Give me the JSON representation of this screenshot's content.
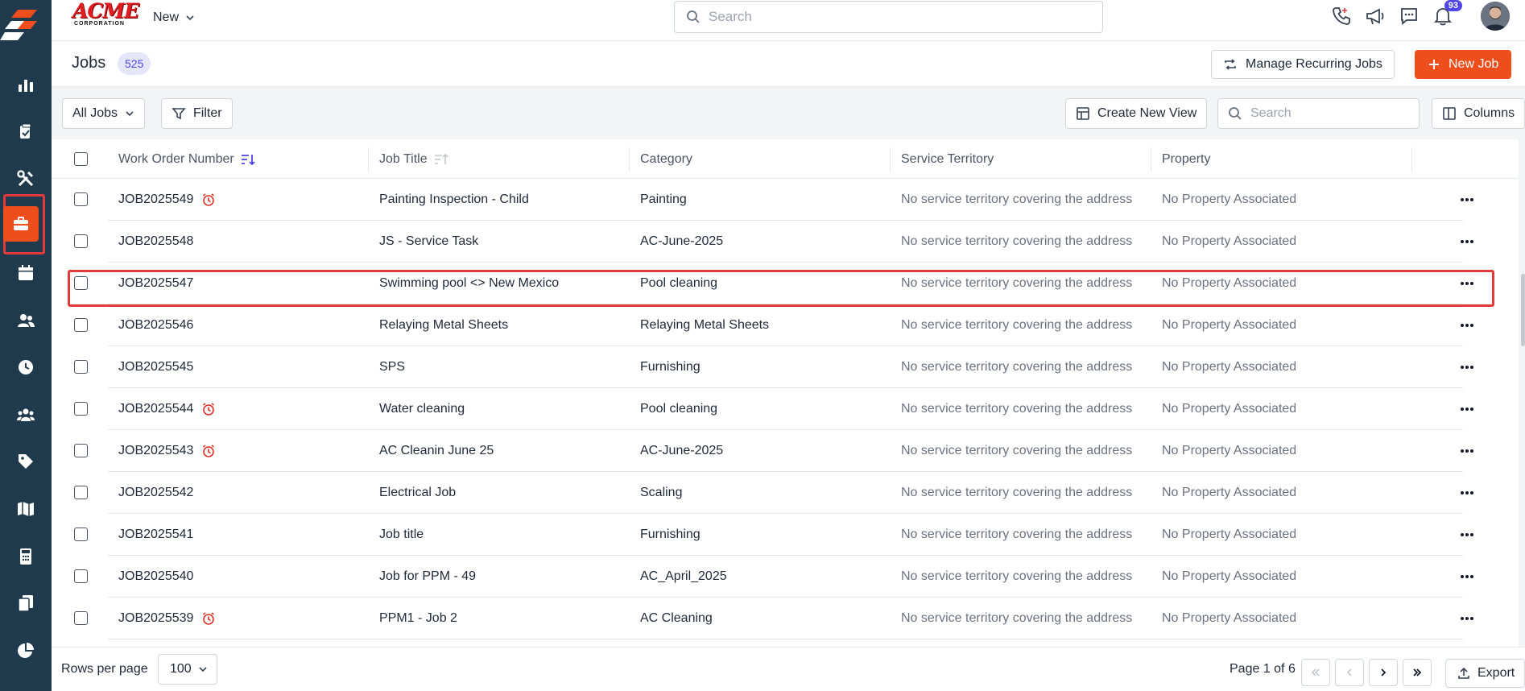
{
  "brand": {
    "name": "ACME",
    "tagline": "CORPORATION"
  },
  "header": {
    "new_label": "New",
    "search_placeholder": "Search",
    "notification_count": "93"
  },
  "title_bar": {
    "title": "Jobs",
    "count": "525",
    "manage_recurring_label": "Manage Recurring Jobs",
    "new_job_label": "New Job"
  },
  "toolbar": {
    "view_select": "All Jobs",
    "filter_label": "Filter",
    "create_view_label": "Create New View",
    "search_placeholder": "Search",
    "columns_label": "Columns"
  },
  "table": {
    "columns": [
      "Work Order Number",
      "Job Title",
      "Category",
      "Service Territory",
      "Property"
    ],
    "rows": [
      {
        "wo": "JOB2025549",
        "alarm": true,
        "title": "Painting Inspection - Child",
        "category": "Painting",
        "territory": "No service territory covering the address",
        "property": "No Property Associated"
      },
      {
        "wo": "JOB2025548",
        "alarm": false,
        "title": "JS - Service Task",
        "category": "AC-June-2025",
        "territory": "No service territory covering the address",
        "property": "No Property Associated"
      },
      {
        "wo": "JOB2025547",
        "alarm": false,
        "title": "Swimming pool <> New Mexico",
        "category": "Pool cleaning",
        "territory": "No service territory covering the address",
        "property": "No Property Associated"
      },
      {
        "wo": "JOB2025546",
        "alarm": false,
        "title": "Relaying Metal Sheets",
        "category": "Relaying Metal Sheets",
        "territory": "No service territory covering the address",
        "property": "No Property Associated"
      },
      {
        "wo": "JOB2025545",
        "alarm": false,
        "title": "SPS",
        "category": "Furnishing",
        "territory": "No service territory covering the address",
        "property": "No Property Associated"
      },
      {
        "wo": "JOB2025544",
        "alarm": true,
        "title": "Water cleaning",
        "category": "Pool cleaning",
        "territory": "No service territory covering the address",
        "property": "No Property Associated"
      },
      {
        "wo": "JOB2025543",
        "alarm": true,
        "title": "AC Cleanin June 25",
        "category": "AC-June-2025",
        "territory": "No service territory covering the address",
        "property": "No Property Associated"
      },
      {
        "wo": "JOB2025542",
        "alarm": false,
        "title": "Electrical Job",
        "category": "Scaling",
        "territory": "No service territory covering the address",
        "property": "No Property Associated"
      },
      {
        "wo": "JOB2025541",
        "alarm": false,
        "title": "Job title",
        "category": "Furnishing",
        "territory": "No service territory covering the address",
        "property": "No Property Associated"
      },
      {
        "wo": "JOB2025540",
        "alarm": false,
        "title": "Job for PPM - 49",
        "category": "AC_April_2025",
        "territory": "No service territory covering the address",
        "property": "No Property Associated"
      },
      {
        "wo": "JOB2025539",
        "alarm": true,
        "title": "PPM1 - Job 2",
        "category": "AC Cleaning",
        "territory": "No service territory covering the address",
        "property": "No Property Associated"
      }
    ]
  },
  "footer": {
    "rows_per_page_label": "Rows per page",
    "rows_per_page_value": "100",
    "page_info": "Page 1 of 6",
    "export_label": "Export"
  },
  "colors": {
    "sidebar": "#1e3a4c",
    "accent": "#ee4e1c",
    "highlight": "#e03a3a",
    "badge": "#4f46e5",
    "alarm": "#d93025"
  },
  "sidebar_icons": [
    "reports-icon",
    "clipboard-icon",
    "tools-icon",
    "jobs-icon",
    "calendar-icon",
    "users-icon",
    "clock-icon",
    "team-icon",
    "tag-icon",
    "map-icon",
    "calculator-icon",
    "documents-icon",
    "pie-chart-icon"
  ]
}
